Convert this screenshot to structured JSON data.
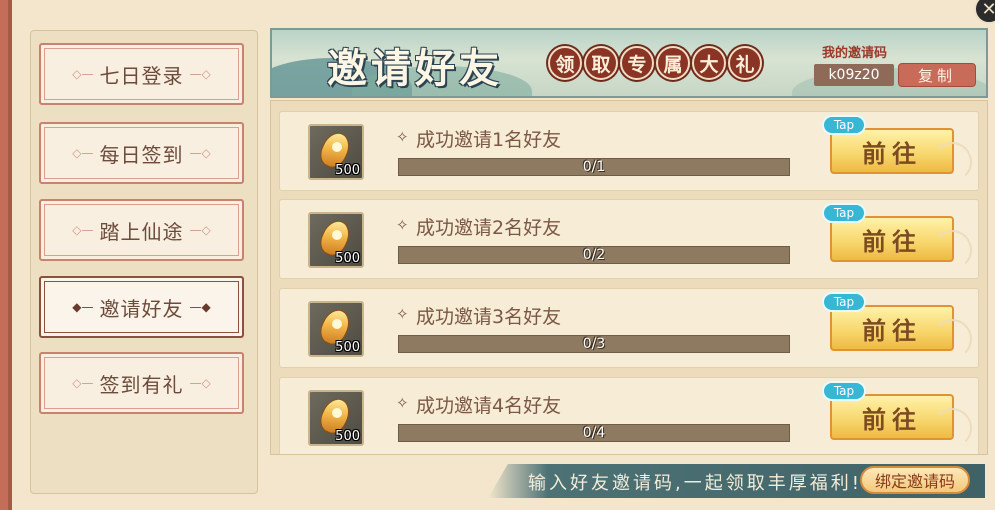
{
  "sidebar": {
    "items": [
      {
        "label": "七日登录",
        "active": false
      },
      {
        "label": "每日签到",
        "active": false
      },
      {
        "label": "踏上仙途",
        "active": false
      },
      {
        "label": "邀请好友",
        "active": true
      },
      {
        "label": "签到有礼",
        "active": false
      }
    ]
  },
  "banner": {
    "title": "邀请好友",
    "gift_chars": [
      "领",
      "取",
      "专",
      "属",
      "大",
      "礼"
    ],
    "invite_code_label": "我的邀请码",
    "invite_code": "k09z20",
    "copy_label": "复制"
  },
  "tasks": [
    {
      "label": "成功邀请1名好友",
      "reward_qty": "500",
      "progress_text": "0/1",
      "progress": 0,
      "tap": "Tap",
      "action": "前往"
    },
    {
      "label": "成功邀请2名好友",
      "reward_qty": "500",
      "progress_text": "0/2",
      "progress": 0,
      "tap": "Tap",
      "action": "前往"
    },
    {
      "label": "成功邀请3名好友",
      "reward_qty": "500",
      "progress_text": "0/3",
      "progress": 0,
      "tap": "Tap",
      "action": "前往"
    },
    {
      "label": "成功邀请4名好友",
      "reward_qty": "500",
      "progress_text": "0/4",
      "progress": 0,
      "tap": "Tap",
      "action": "前往"
    }
  ],
  "footer": {
    "prompt": "输入好友邀请码,一起领取丰厚福利!",
    "bind_label": "绑定邀请码"
  },
  "icons": {
    "close": "close-icon",
    "reward": "gem-icon",
    "star": "sparkle-icon",
    "ornament": "diamond-ornament-icon"
  },
  "colors": {
    "accent": "#c86b58",
    "tap": "#37b7d3",
    "button": "#f7d56a"
  }
}
